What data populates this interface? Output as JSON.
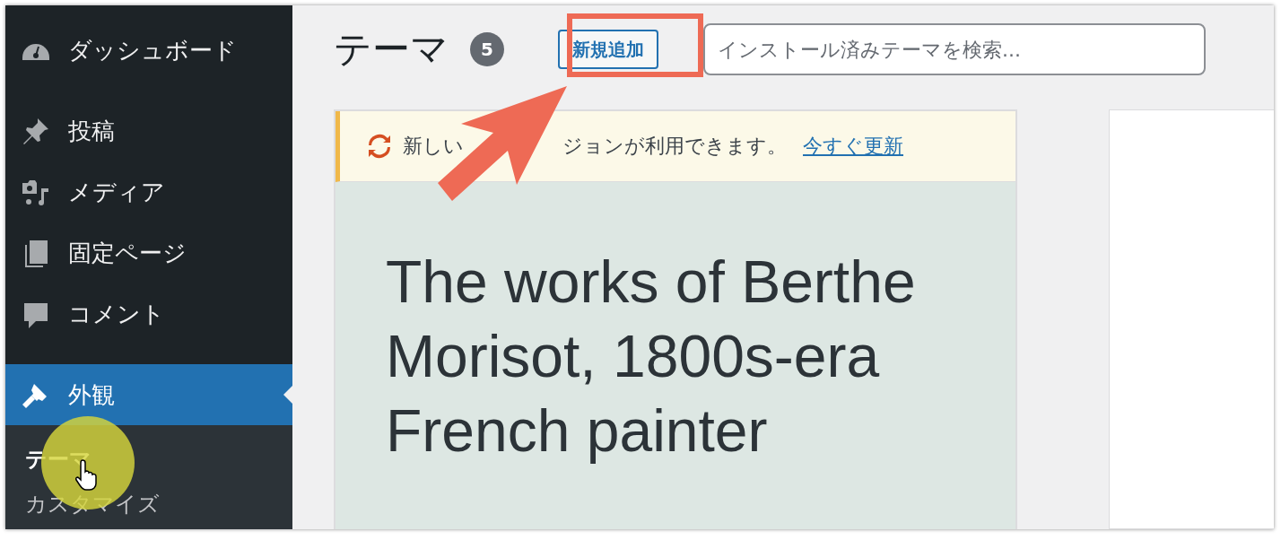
{
  "sidebar": {
    "items": [
      {
        "label": "ダッシュボード",
        "selected": false
      },
      {
        "label": "投稿",
        "selected": false
      },
      {
        "label": "メディア",
        "selected": false
      },
      {
        "label": "固定ページ",
        "selected": false
      },
      {
        "label": "コメント",
        "selected": false
      },
      {
        "label": "外観",
        "selected": true,
        "children": [
          {
            "label": "テーマ",
            "selected": true
          },
          {
            "label": "カスタマイズ",
            "selected": false
          }
        ]
      }
    ]
  },
  "header": {
    "title": "テーマ",
    "count": "5",
    "add_button": "新規追加",
    "search": {
      "placeholder": "インストール済みテーマを検索..."
    }
  },
  "theme_card": {
    "notice": {
      "text_before": "新しい",
      "text_after": "ジョンが利用できます。",
      "link": "今すぐ更新"
    },
    "preview_lines": [
      "The works of Berthe",
      "Morisot, 1800s-era",
      "French painter"
    ]
  }
}
